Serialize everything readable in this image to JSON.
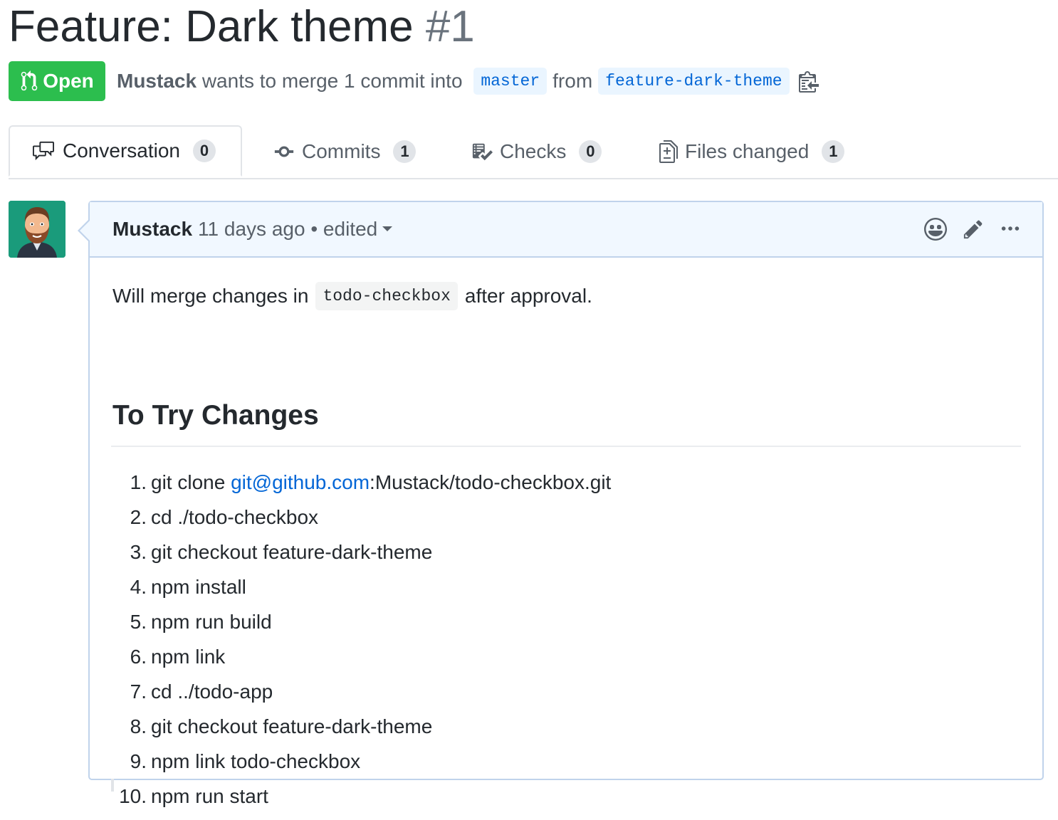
{
  "pr": {
    "title": "Feature: Dark theme",
    "number": "#1",
    "state": "Open",
    "author": "Mustack",
    "merge_text": "wants to merge 1 commit into",
    "base_branch": "master",
    "from_text": "from",
    "head_branch": "feature-dark-theme"
  },
  "tabs": [
    {
      "label": "Conversation",
      "count": "0",
      "icon": "comment-discussion-icon",
      "selected": true
    },
    {
      "label": "Commits",
      "count": "1",
      "icon": "git-commit-icon"
    },
    {
      "label": "Checks",
      "count": "0",
      "icon": "checklist-icon"
    },
    {
      "label": "Files changed",
      "count": "1",
      "icon": "diff-icon"
    }
  ],
  "comment": {
    "author": "Mustack",
    "time": "11 days ago",
    "separator": "•",
    "edited": "edited",
    "body_before": "Will merge changes in",
    "body_code": "todo-checkbox",
    "body_after": "after approval.",
    "heading": "To Try Changes",
    "steps": [
      {
        "num": "1.",
        "prefix": "git clone ",
        "link": "git@github.com",
        "suffix": ":Mustack/todo-checkbox.git"
      },
      {
        "num": "2.",
        "text": "cd ./todo-checkbox"
      },
      {
        "num": "3.",
        "text": "git checkout feature-dark-theme"
      },
      {
        "num": "4.",
        "text": "npm install"
      },
      {
        "num": "5.",
        "text": "npm run build"
      },
      {
        "num": "6.",
        "text": "npm link"
      },
      {
        "num": "7.",
        "text": "cd ../todo-app"
      },
      {
        "num": "8.",
        "text": "git checkout feature-dark-theme"
      },
      {
        "num": "9.",
        "text": "npm link todo-checkbox"
      },
      {
        "num": "10.",
        "text": "npm run start"
      }
    ]
  },
  "colors": {
    "open_green": "#2cbe4e",
    "link_blue": "#0366d6",
    "comment_header_bg": "#f1f8ff"
  }
}
